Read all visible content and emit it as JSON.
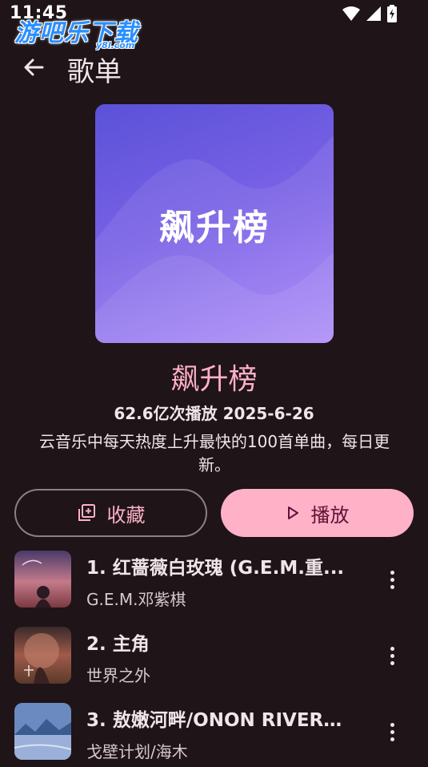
{
  "status_bar": {
    "time": "11:45"
  },
  "watermark": {
    "text": "游吧乐下载",
    "sub": "y8l.com"
  },
  "header": {
    "title": "歌单"
  },
  "playlist": {
    "cover_text": "飙升榜",
    "title": "飙升榜",
    "play_info": "62.6亿次播放 2025-6-26",
    "description": "云音乐中每天热度上升最快的100首单曲，每日更新。"
  },
  "actions": {
    "collect_label": "收藏",
    "play_label": "播放"
  },
  "songs": [
    {
      "title": "1. 红蔷薇白玫瑰 (G.E.M.重...",
      "artist": "G.E.M.邓紫棋"
    },
    {
      "title": "2. 主角",
      "artist": "世界之外"
    },
    {
      "title": "3. 敖嫩河畔/ONON RIVERSI...",
      "artist": "戈壁计划/海木"
    }
  ],
  "colors": {
    "background": "#1f1418",
    "accent": "#ffb1c8",
    "on_accent": "#5e1133",
    "outline": "#8e7f84"
  }
}
